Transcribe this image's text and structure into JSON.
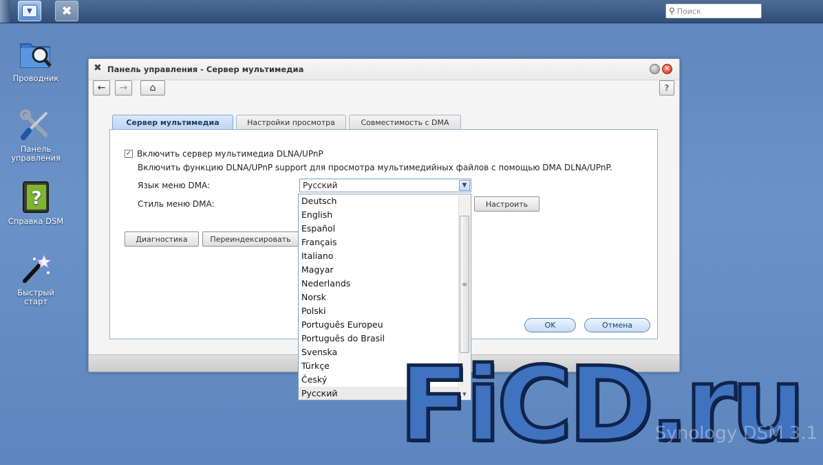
{
  "taskbar": {
    "search_placeholder": "Поиск",
    "main_menu_icon": "main-menu-icon",
    "control_panel_icon": "tools-icon"
  },
  "desktop": {
    "icons": [
      {
        "label": "Проводник",
        "icon": "folder-search-icon"
      },
      {
        "label": "Панель управления",
        "icon": "tools-icon"
      },
      {
        "label": "Справка DSM",
        "icon": "help-book-icon"
      },
      {
        "label": "Быстрый старт",
        "icon": "magic-wand-icon"
      }
    ]
  },
  "window": {
    "title": "Панель управления - Сервер мультимедиа",
    "help": "?",
    "tabs": [
      {
        "label": "Сервер мультимедиа",
        "active": true
      },
      {
        "label": "Настройки просмотра",
        "active": false
      },
      {
        "label": "Совместимость с DMA",
        "active": false
      }
    ],
    "enable_checkbox": {
      "label": "Включить сервер мультимедиа DLNA/UPnP",
      "checked": true
    },
    "description": "Включить функцию DLNA/UPnP support для просмотра мультимедийных файлов с помощью DMA DLNA/UPnP.",
    "language_label": "Язык меню DMA:",
    "language_value": "Русский",
    "style_label": "Стиль меню DMA:",
    "configure_button": "Настроить",
    "diagnostics_button": "Диагностика",
    "reindex_button": "Переиндексировать",
    "ok_button": "OK",
    "cancel_button": "Отмена"
  },
  "dropdown": {
    "options": [
      "Deutsch",
      "English",
      "Español",
      "Français",
      "Italiano",
      "Magyar",
      "Nederlands",
      "Norsk",
      "Polski",
      "Português Europeu",
      "Português do Brasil",
      "Svenska",
      "Türkçe",
      "Český",
      "Русский"
    ],
    "selected": "Русский"
  },
  "watermark": {
    "site": "FiCD.ru",
    "brand": "Synology DSM 3.1"
  },
  "colors": {
    "desktop": "#6a93c8",
    "accent": "#bcd4f0",
    "close": "#d22d1f"
  }
}
